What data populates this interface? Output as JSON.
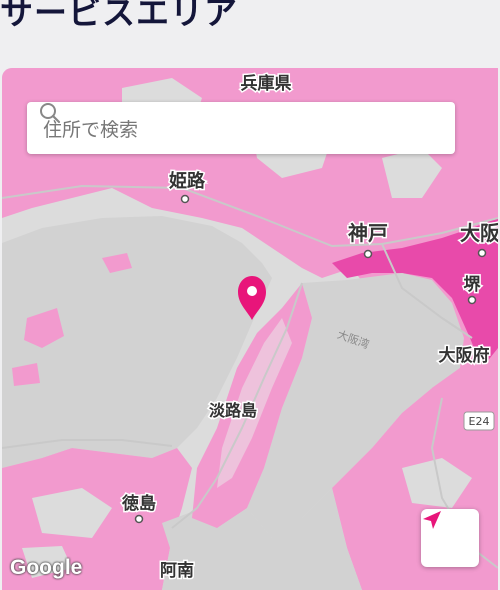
{
  "page": {
    "title": "サービスエリア"
  },
  "search": {
    "placeholder": "住所で検索",
    "icon": "search-icon"
  },
  "map": {
    "coverage_color": "#f08bc8",
    "coverage_dense_color": "#e84aaa",
    "land_color": "#d8d8d8",
    "water_color": "#d4d4d4",
    "marker_color": "#e8157a",
    "labels": {
      "hyogo": "兵庫県",
      "himeji": "姫路",
      "kobe": "神戸",
      "osaka": "大阪",
      "sakai": "堺",
      "osaka_bay": "大阪湾",
      "osaka_pref": "大阪府",
      "awaji": "淡路島",
      "tokushima": "徳島",
      "anan": "阿南",
      "route": "E24"
    }
  },
  "controls": {
    "locate_icon": "navigation-arrow-icon"
  },
  "attribution": {
    "logo": "Google"
  }
}
